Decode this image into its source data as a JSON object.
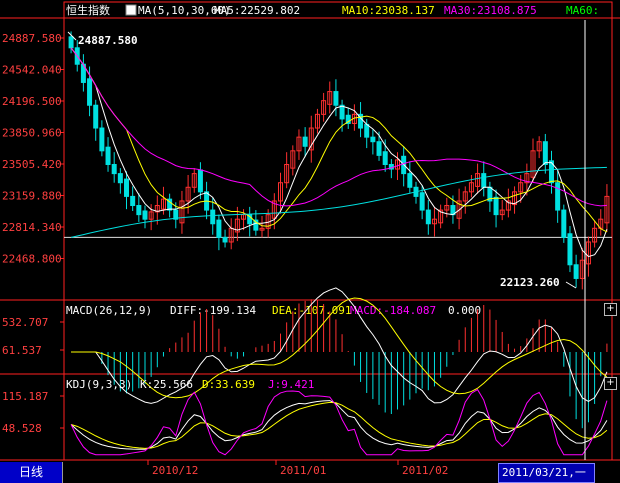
{
  "main": {
    "title": "恒生指数",
    "ma_spec": "MA(5,10,30,60)",
    "ma5": "MA5:22529.802",
    "ma10": "MA10:23038.137",
    "ma30": "MA30:23108.875",
    "ma60": "MA60:",
    "y_ticks": [
      "24887.580",
      "24542.040",
      "24196.500",
      "23850.960",
      "23505.420",
      "23159.880",
      "22814.340",
      "22468.800"
    ],
    "high_label": "24887.580",
    "low_label": "22123.260"
  },
  "macd": {
    "spec": "MACD(26,12,9)",
    "diff": "DIFF:-199.134",
    "dea": "DEA:-107.091",
    "macd": "MACD:-184.087",
    "extra": "0.000",
    "y_ticks": [
      "532.707",
      "61.537"
    ]
  },
  "kdj": {
    "spec": "KDJ(9,3,3)",
    "k": "K:25.566",
    "d": "D:33.639",
    "j": "J:9.421",
    "y_ticks": [
      "115.187",
      "48.528"
    ]
  },
  "x_axis": {
    "labels": [
      "2010/12",
      "2011/01",
      "2011/02"
    ]
  },
  "footer": {
    "tab_label": "日线",
    "cursor_date": "2011/03/21,一"
  },
  "colors": {
    "up": "#ff3030",
    "down": "#00e0e0",
    "ma5": "#ffffff",
    "ma10": "#ffff00",
    "ma30": "#ff00ff",
    "ma60": "#00ff00",
    "axis": "#ff2020"
  },
  "chart_data": {
    "type": "candlestick",
    "ylim": [
      22123.26,
      24887.58
    ],
    "closes": [
      24780,
      24600,
      24400,
      24150,
      23900,
      23650,
      23500,
      23400,
      23300,
      23150,
      23050,
      22950,
      22900,
      22980,
      23050,
      23120,
      23000,
      22900,
      23100,
      23250,
      23400,
      23200,
      23000,
      22850,
      22700,
      22650,
      22800,
      22900,
      22950,
      22850,
      22780,
      22800,
      22950,
      23100,
      23300,
      23500,
      23650,
      23800,
      23700,
      23900,
      24050,
      24200,
      24300,
      24150,
      24000,
      23950,
      24050,
      23900,
      23800,
      23750,
      23600,
      23500,
      23450,
      23550,
      23400,
      23250,
      23150,
      23000,
      22850,
      22900,
      23000,
      23050,
      22950,
      23100,
      23200,
      23300,
      23400,
      23250,
      23100,
      22950,
      23000,
      23100,
      23200,
      23300,
      23400,
      23650,
      23750,
      23500,
      23300,
      23000,
      22700,
      22400,
      22250,
      22450,
      22650,
      22800,
      22900,
      23150
    ]
  }
}
